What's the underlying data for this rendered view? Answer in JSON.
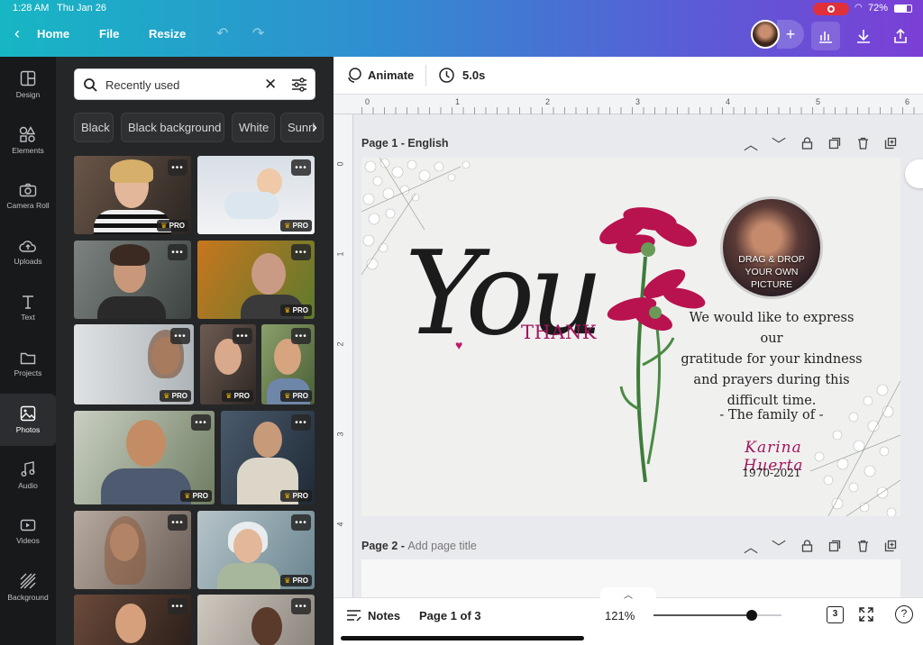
{
  "status": {
    "time": "1:28 AM",
    "date": "Thu Jan 26",
    "battery": "72%"
  },
  "nav": {
    "home": "Home",
    "file": "File",
    "resize": "Resize"
  },
  "rail": [
    {
      "label": "Design"
    },
    {
      "label": "Elements"
    },
    {
      "label": "Camera Roll"
    },
    {
      "label": "Uploads"
    },
    {
      "label": "Text"
    },
    {
      "label": "Projects"
    },
    {
      "label": "Photos"
    },
    {
      "label": "Audio"
    },
    {
      "label": "Videos"
    },
    {
      "label": "Background"
    }
  ],
  "search": {
    "value": "Recently used"
  },
  "chips": [
    "Black",
    "Black background",
    "White",
    "Sunri"
  ],
  "pro_label": "PRO",
  "toolbar": {
    "animate": "Animate",
    "duration": "5.0s"
  },
  "ruler": {
    "h": [
      "0",
      "1",
      "2",
      "3",
      "4",
      "5",
      "6"
    ],
    "v": [
      "0",
      "1",
      "2",
      "3",
      "4"
    ]
  },
  "pages": {
    "page1_title": "Page 1 - English",
    "page2_title": "Page 2 - ",
    "page2_placeholder": "Add page title"
  },
  "card": {
    "thank": "THANK",
    "you": "You",
    "placeholder": "DRAG & DROP YOUR OWN PICTURE",
    "message_lines": [
      "We would like to express our",
      "gratitude for your kindness",
      "and prayers during this",
      "difficult time."
    ],
    "family": "- The family of -",
    "name": "Karina Huerta",
    "years": "1970-2021"
  },
  "bottom": {
    "notes": "Notes",
    "page_indicator": "Page 1 of 3",
    "zoom": "121%",
    "page_count": "3"
  },
  "colors": {
    "accent": "#a3145e",
    "brand_from": "#17b6c4",
    "brand_to": "#7b3fd6"
  }
}
